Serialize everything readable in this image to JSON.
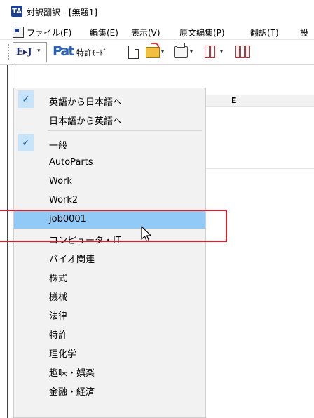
{
  "window": {
    "title": "対訳翻訳 - [無題1]",
    "logo_text": "TA"
  },
  "menubar": {
    "items": [
      {
        "label": "ファイル(F)"
      },
      {
        "label": "編集(E)"
      },
      {
        "label": "表示(V)"
      },
      {
        "label": "原文編集(P)"
      },
      {
        "label": "翻訳(T)"
      },
      {
        "label": "設"
      }
    ]
  },
  "toolbar": {
    "direction_button": "E▸J",
    "pat_icon_text": "Pat",
    "patent_mode_label": "特許ﾓｰﾄﾞ",
    "dropdown_glyph": "▾"
  },
  "grid": {
    "column_header": "E"
  },
  "dropdown": {
    "direction_items": [
      {
        "label": "英語から日本語へ",
        "checked": true
      },
      {
        "label": "日本語から英語へ",
        "checked": false
      }
    ],
    "dictionary_items": [
      {
        "label": "一般",
        "checked": true,
        "active": false
      },
      {
        "label": "AutoParts",
        "checked": false,
        "active": false
      },
      {
        "label": "Work",
        "checked": false,
        "active": false
      },
      {
        "label": "Work2",
        "checked": false,
        "active": false
      },
      {
        "label": "job0001",
        "checked": false,
        "active": true
      },
      {
        "label": "コンピュータ・IT",
        "checked": false,
        "active": false
      },
      {
        "label": "バイオ関連",
        "checked": false,
        "active": false
      },
      {
        "label": "株式",
        "checked": false,
        "active": false
      },
      {
        "label": "機械",
        "checked": false,
        "active": false
      },
      {
        "label": "法律",
        "checked": false,
        "active": false
      },
      {
        "label": "特許",
        "checked": false,
        "active": false
      },
      {
        "label": "理化学",
        "checked": false,
        "active": false
      },
      {
        "label": "趣味・娯楽",
        "checked": false,
        "active": false
      },
      {
        "label": "金融・経済",
        "checked": false,
        "active": false
      }
    ],
    "check_glyph": "✓"
  },
  "colors": {
    "highlight_box": "#d6202a",
    "active_item": "#91c9f7",
    "check_bg": "#c8e4fb"
  }
}
